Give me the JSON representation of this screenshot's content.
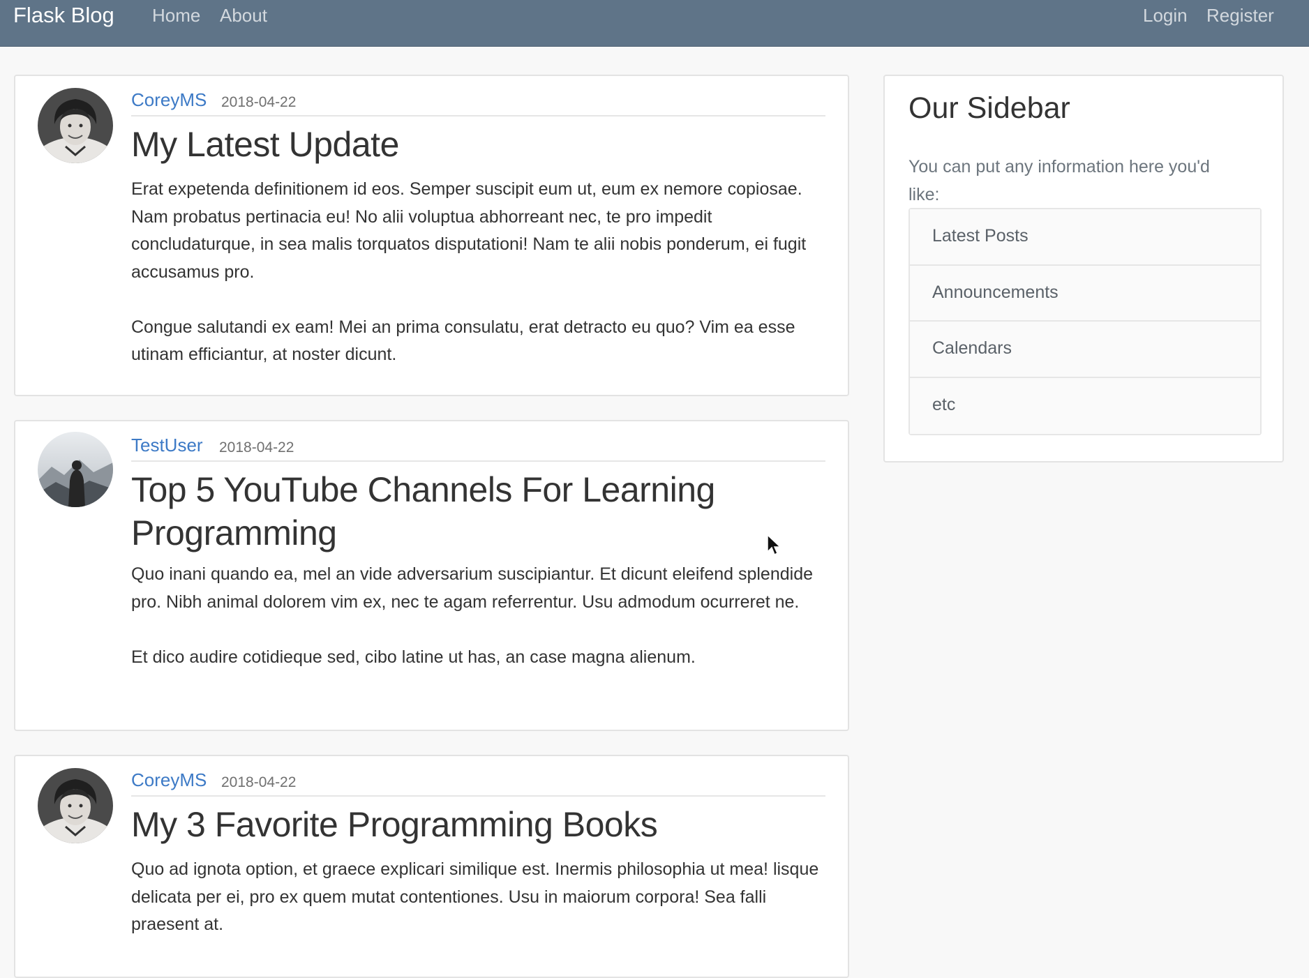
{
  "navbar": {
    "brand": "Flask Blog",
    "links_left": [
      "Home",
      "About"
    ],
    "links_right": [
      "Login",
      "Register"
    ],
    "background": "#5f7488"
  },
  "posts": [
    {
      "author": "CoreyMS",
      "date": "2018-04-22",
      "title": "My Latest Update",
      "avatar": "person-portrait-icon",
      "paragraphs": [
        "Erat expetenda definitionem id eos. Semper suscipit eum ut, eum ex nemore copiosae. Nam probatus pertinacia eu! No alii voluptua abhorreant nec, te pro impedit concludaturque, in sea malis torquatos disputationi! Nam te alii nobis ponderum, ei fugit accusamus pro.",
        "Congue salutandi ex eam! Mei an prima consulatu, erat detracto eu quo? Vim ea esse utinam efficiantur, at noster dicunt."
      ]
    },
    {
      "author": "TestUser",
      "date": "2018-04-22",
      "title": "Top 5 YouTube Channels For Learning Programming",
      "avatar": "mountain-silhouette-icon",
      "paragraphs": [
        "Quo inani quando ea, mel an vide adversarium suscipiantur. Et dicunt eleifend splendide pro. Nibh animal dolorem vim ex, nec te agam referrentur. Usu admodum ocurreret ne.",
        "Et dico audire cotidieque sed, cibo latine ut has, an case magna alienum."
      ]
    },
    {
      "author": "CoreyMS",
      "date": "2018-04-22",
      "title": "My 3 Favorite Programming Books",
      "avatar": "person-portrait-icon",
      "paragraphs": [
        "Quo ad ignota option, et graece explicari similique est. Inermis philosophia ut mea! lisque delicata per ei, pro ex quem mutat contentiones. Usu in maiorum corpora! Sea falli praesent at."
      ]
    }
  ],
  "sidebar": {
    "title": "Our Sidebar",
    "text": "You can put any information here you'd like:",
    "items": [
      "Latest Posts",
      "Announcements",
      "Calendars",
      "etc"
    ]
  },
  "colors": {
    "link": "#3d7ac6",
    "muted": "#707070",
    "page_background": "#f8f8f8"
  }
}
